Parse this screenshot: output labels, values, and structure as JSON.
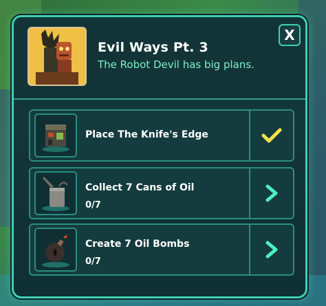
{
  "quest": {
    "title": "Evil Ways Pt. 3",
    "subtitle": "The Robot Devil has big plans.",
    "close_label": "X",
    "portrait_icon": "robot-devil-portrait"
  },
  "tasks": [
    {
      "label": "Place The Knife's Edge",
      "progress": "",
      "status": "complete",
      "icon": "knifes-edge-building-icon",
      "action_icon": "checkmark-icon"
    },
    {
      "label": "Collect 7 Cans of Oil",
      "progress": "0/7",
      "status": "in-progress",
      "icon": "oil-can-icon",
      "action_icon": "chevron-right-icon"
    },
    {
      "label": "Create 7 Oil Bombs",
      "progress": "0/7",
      "status": "in-progress",
      "icon": "oil-bomb-icon",
      "action_icon": "chevron-right-icon"
    }
  ],
  "colors": {
    "accent": "#3fd0b3",
    "subtitle": "#7ff0c8",
    "check": "#f5e14a",
    "chevron": "#4ff0c0"
  }
}
